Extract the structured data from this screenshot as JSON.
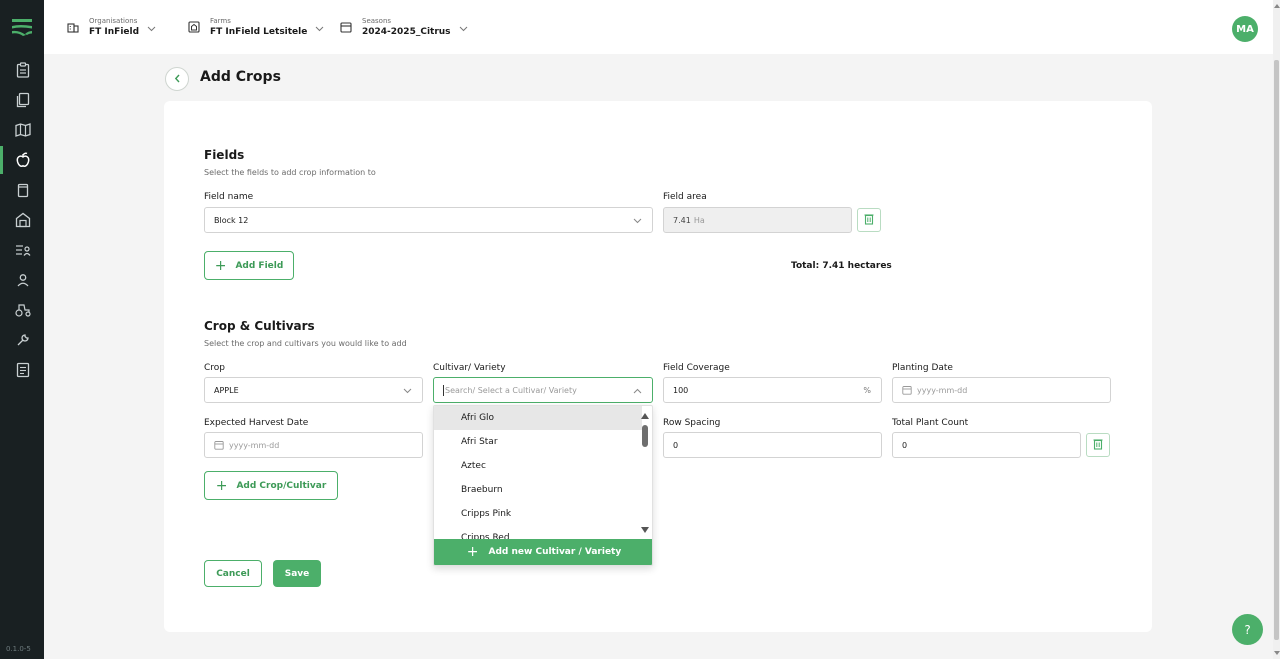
{
  "app": {
    "version": "0.1.0-5"
  },
  "topbar": {
    "organisation": {
      "label": "Organisations",
      "value": "FT InField"
    },
    "farm": {
      "label": "Farms",
      "value": "FT InField Letsitele"
    },
    "season": {
      "label": "Seasons",
      "value": "2024-2025_Citrus"
    },
    "avatar_initials": "MA"
  },
  "page": {
    "title": "Add Crops"
  },
  "fields_section": {
    "title": "Fields",
    "subtitle": "Select the fields to add crop information to",
    "field_name_label": "Field name",
    "field_name_value": "Block 12",
    "field_area_label": "Field area",
    "field_area_value": "7.41",
    "field_area_unit": "Ha",
    "add_field_label": "Add Field",
    "total_label": "Total: 7.41 hectares"
  },
  "crop_section": {
    "title": "Crop & Cultivars",
    "subtitle": "Select the crop and cultivars you would like to add",
    "crop_label": "Crop",
    "crop_value": "APPLE",
    "cultivar_label": "Cultivar/ Variety",
    "cultivar_placeholder": "Search/ Select a Cultivar/ Variety",
    "coverage_label": "Field Coverage",
    "coverage_value": "100",
    "coverage_unit": "%",
    "planting_label": "Planting Date",
    "planting_placeholder": "yyyy-mm-dd",
    "harvest_label": "Expected Harvest Date",
    "harvest_placeholder": "yyyy-mm-dd",
    "row_spacing_label": "Row Spacing",
    "row_spacing_value": "0",
    "plant_count_label": "Total Plant Count",
    "plant_count_value": "0",
    "add_crop_label": "Add Crop/Cultivar"
  },
  "cultivar_dropdown": {
    "options": [
      "Afri Glo",
      "Afri Star",
      "Aztec",
      "Braeburn",
      "Cripps Pink",
      "Cripps Red"
    ],
    "add_new_label": "Add new Cultivar / Variety"
  },
  "actions": {
    "cancel_label": "Cancel",
    "save_label": "Save"
  },
  "help": {
    "label": "?"
  },
  "colors": {
    "accent": "#4caf6a",
    "sidebar": "#192022",
    "background": "#f4f4f4"
  },
  "icons": {
    "sidebar": [
      "logo-icon",
      "clipboard-icon",
      "copy-icon",
      "map-icon",
      "apple-icon",
      "cup-icon",
      "barn-icon",
      "list-person-icon",
      "person-icon",
      "tractor-icon",
      "wrench-icon",
      "document-icon"
    ]
  }
}
